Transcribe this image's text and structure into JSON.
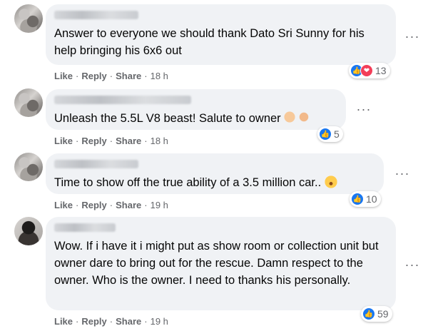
{
  "comments": [
    {
      "text": "Answer to everyone we should thank Dato Sri Sunny for his help bringing his 6x6 out",
      "actions": {
        "like": "Like",
        "reply": "Reply",
        "share": "Share",
        "time": "18 h"
      },
      "reactions": {
        "count": "13",
        "types": [
          "like-icon",
          "love-icon"
        ]
      },
      "more_label": "···"
    },
    {
      "text": "Unleash the 5.5L V8 beast! Salute to owner",
      "emoji": "flexed-biceps-and-praying-hands",
      "actions": {
        "like": "Like",
        "reply": "Reply",
        "share": "Share",
        "time": "18 h"
      },
      "reactions": {
        "count": "5",
        "types": [
          "like-icon"
        ]
      },
      "more_label": "···"
    },
    {
      "text": "Time to show off the true ability of a 3.5 million car..",
      "emoji": "astonished-face",
      "actions": {
        "like": "Like",
        "reply": "Reply",
        "share": "Share",
        "time": "19 h"
      },
      "reactions": {
        "count": "10",
        "types": [
          "like-icon"
        ]
      },
      "more_label": "···"
    },
    {
      "text": "Wow. If i have it i might put as show room or collection unit but owner dare to bring out for the rescue. Damn respect to the owner. Who is the owner. I need to thanks his personally.",
      "actions": {
        "like": "Like",
        "reply": "Reply",
        "share": "Share",
        "time": "19 h"
      },
      "reactions": {
        "count": "59",
        "types": [
          "like-icon"
        ]
      },
      "more_label": "···"
    }
  ],
  "colors": {
    "like": "#1877f2",
    "love": "#f33e58",
    "bubble": "#f0f2f5",
    "meta": "#65676b"
  }
}
